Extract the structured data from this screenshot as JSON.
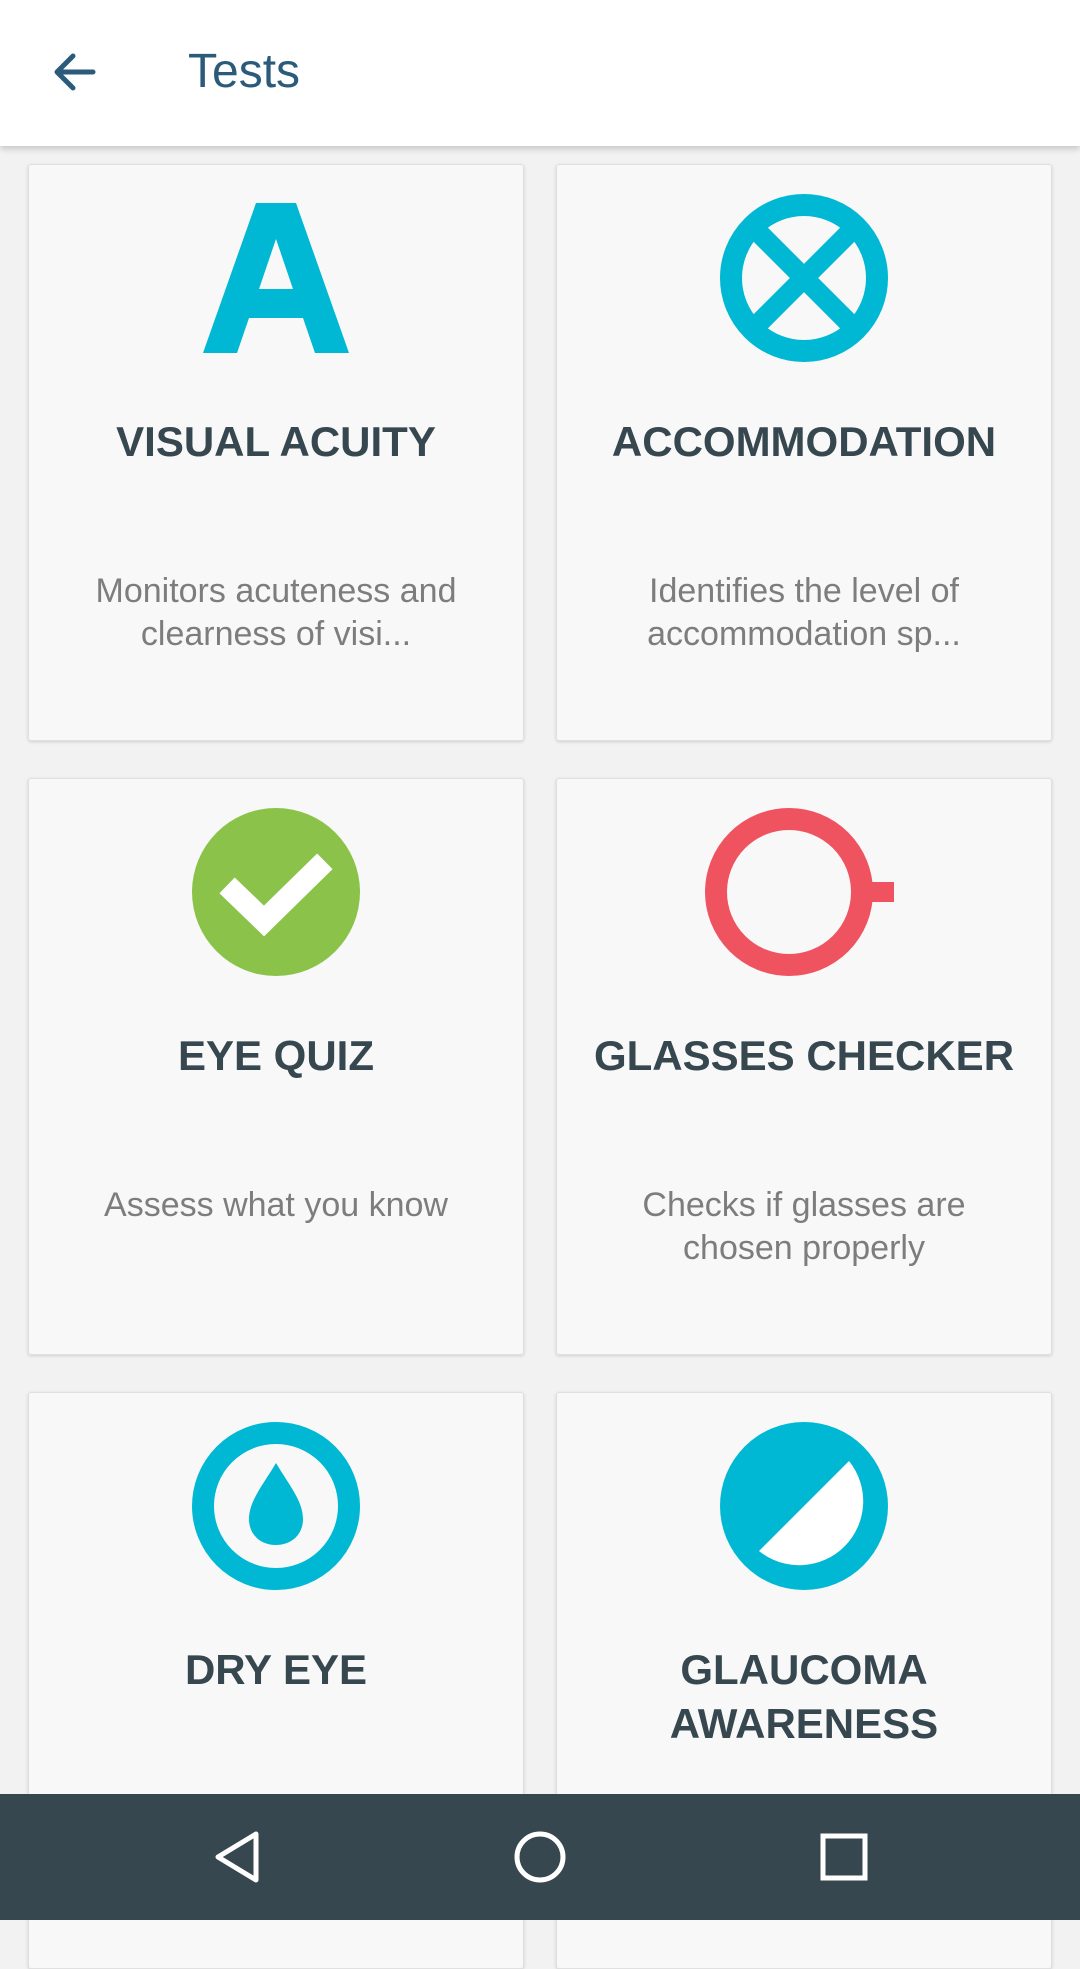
{
  "header": {
    "back_icon": "arrow-left-icon",
    "title": "Tests"
  },
  "colors": {
    "accent": "#00b8d4",
    "green": "#8bc34a",
    "red": "#ef5360",
    "title": "#2b5a7a",
    "card_text": "#37474f",
    "nav_bg": "#37474f"
  },
  "tests": [
    {
      "icon": "letter-a-icon",
      "name": "VISUAL ACUITY",
      "desc": "Monitors acuteness and clearness of visi..."
    },
    {
      "icon": "crossed-circle-icon",
      "name": "ACCOMMODATION",
      "desc": "Identifies the level of accommodation sp..."
    },
    {
      "icon": "checkmark-circle-icon",
      "name": "EYE QUIZ",
      "desc": "Assess what you know"
    },
    {
      "icon": "ring-icon",
      "name": "GLASSES CHECKER",
      "desc": "Checks if glasses are chosen properly"
    },
    {
      "icon": "drop-in-circle-icon",
      "name": "DRY EYE",
      "desc": ""
    },
    {
      "icon": "half-circle-icon",
      "name": "GLAUCOMA AWARENESS",
      "desc": ""
    }
  ],
  "navbar": {
    "back": "triangle-back-icon",
    "home": "circle-home-icon",
    "recents": "square-recents-icon"
  }
}
